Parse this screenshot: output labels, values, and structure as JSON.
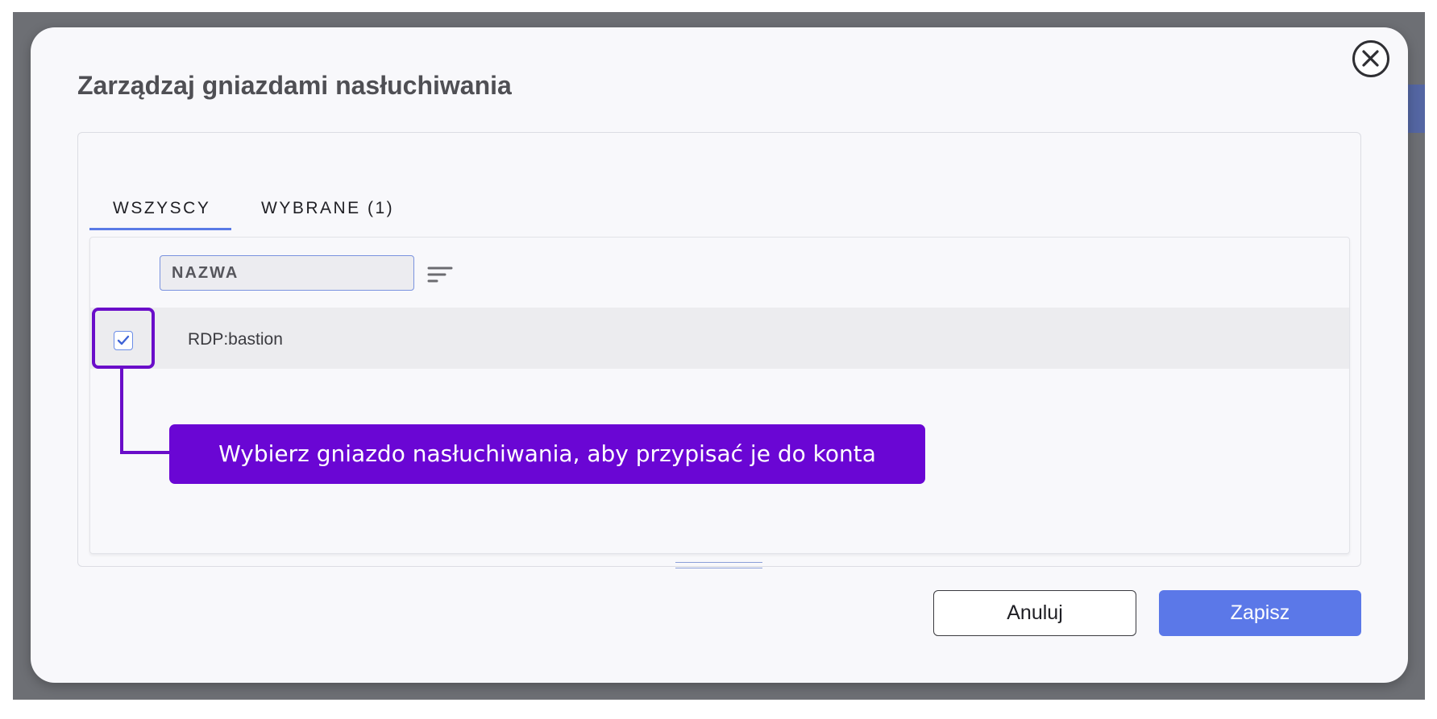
{
  "dialog": {
    "title": "Zarządzaj gniazdami nasłuchiwania",
    "close_icon": "close-circle-icon"
  },
  "tabs": [
    {
      "label": "WSZYSCY",
      "active": true
    },
    {
      "label": "WYBRANE (1)",
      "active": false
    }
  ],
  "table": {
    "filter_placeholder": "NAZWA",
    "sort_icon": "sort-lines-icon",
    "rows": [
      {
        "name": "RDP:bastion",
        "checked": true
      }
    ]
  },
  "callout": {
    "text": "Wybierz gniazdo nasłuchiwania, aby przypisać je do konta"
  },
  "buttons": {
    "cancel_label": "Anuluj",
    "save_label": "Zapisz"
  },
  "colors": {
    "accent": "#5b78e8",
    "callout": "#6a06d4",
    "title": "#4f4f54"
  }
}
